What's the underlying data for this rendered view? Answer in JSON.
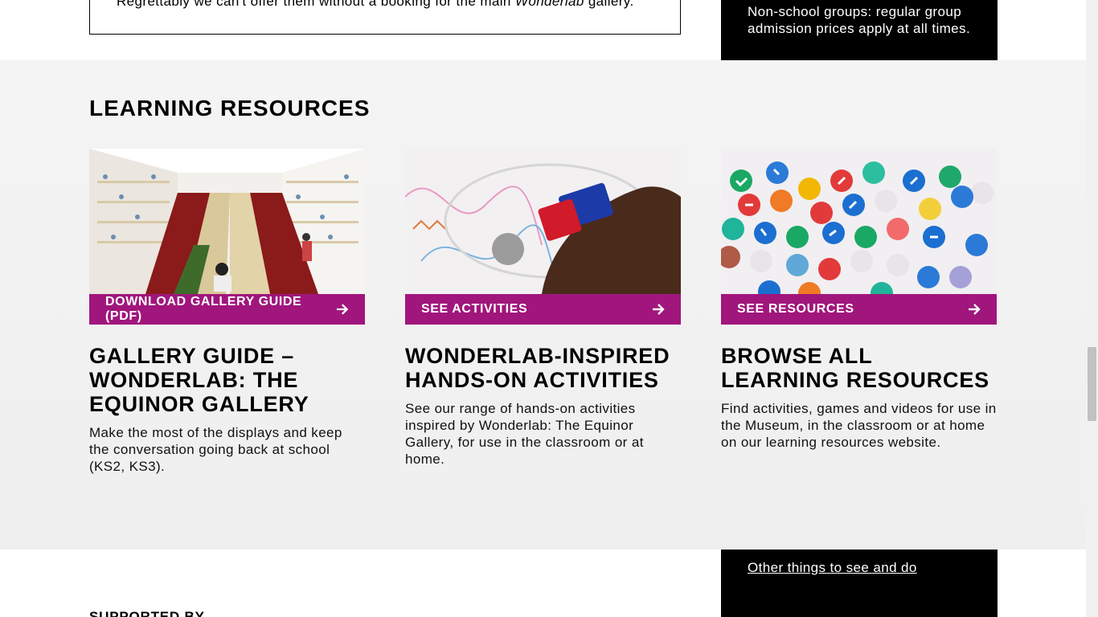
{
  "notice": {
    "text_before": "Regrettably we can't offer them without a booking for the main ",
    "text_em": "Wonderlab",
    "text_after": " gallery."
  },
  "sidebar_top": {
    "text": "Non-school groups: regular group admission prices apply at all times."
  },
  "section": {
    "title": "LEARNING RESOURCES"
  },
  "cards": [
    {
      "button_label": "DOWNLOAD GALLERY GUIDE (PDF)",
      "heading": "GALLERY GUIDE – WONDERLAB: THE EQUINOR GALLERY",
      "body": "Make the most of the displays and keep the conversation going back at school (KS2, KS3)."
    },
    {
      "button_label": "SEE ACTIVITIES",
      "heading": "WONDERLAB-INSPIRED HANDS-ON ACTIVITIES",
      "body": "See our range of hands-on activities inspired by Wonderlab: The Equinor Gallery, for use in the classroom or at home."
    },
    {
      "button_label": "SEE RESOURCES",
      "heading": "BROWSE ALL LEARNING RESOURCES",
      "body": "Find activities, games and videos for use in the Museum, in the classroom or at home on our learning resources website."
    }
  ],
  "sidebar_bottom": {
    "link": "Other things to see and do"
  },
  "supported_by": "SUPPORTED BY",
  "colors": {
    "accent": "#a0167c",
    "band": "#f1f1f1",
    "sidebar": "#000000"
  }
}
